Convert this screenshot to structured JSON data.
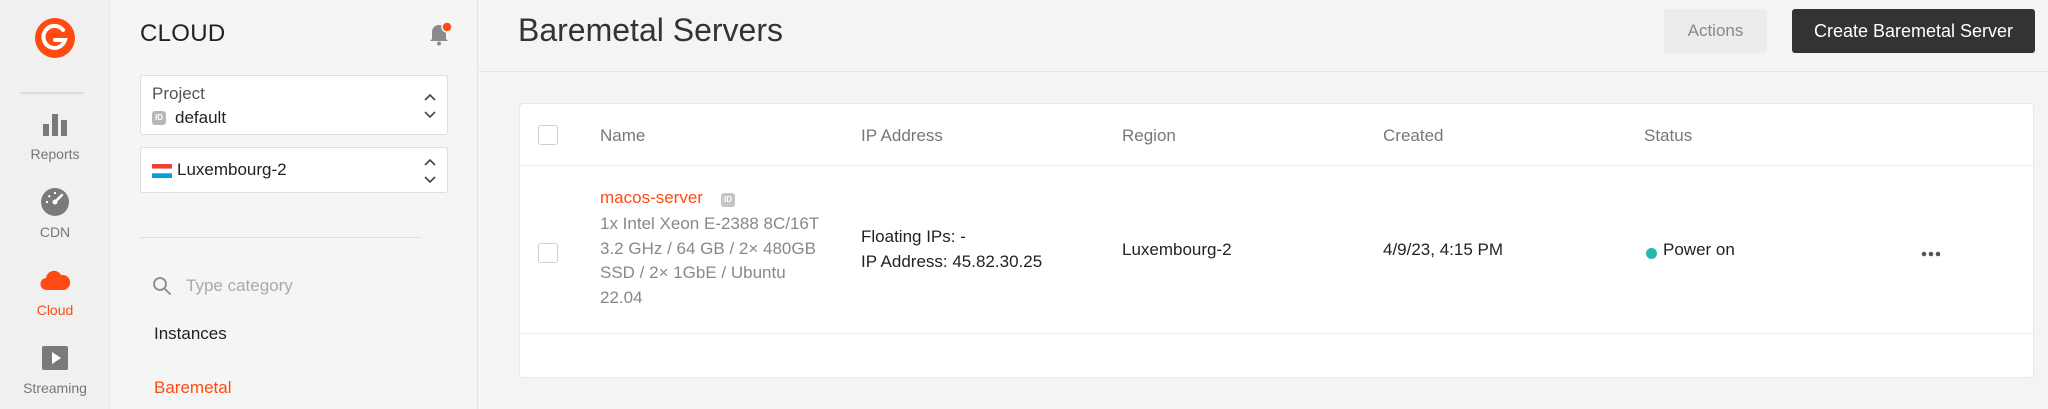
{
  "rail": {
    "items": [
      {
        "label": "Reports",
        "icon": "bar-chart-icon"
      },
      {
        "label": "CDN",
        "icon": "speedometer-icon"
      },
      {
        "label": "Cloud",
        "icon": "cloud-icon",
        "active": true
      },
      {
        "label": "Streaming",
        "icon": "play-icon"
      }
    ]
  },
  "sidebar": {
    "title": "CLOUD",
    "project": {
      "caption": "Project",
      "id_badge": "ID",
      "value": "default"
    },
    "region": {
      "value": "Luxembourg-2"
    },
    "search": {
      "placeholder": "Type category"
    },
    "categories": [
      "Instances",
      "Baremetal"
    ]
  },
  "header": {
    "title": "Baremetal Servers",
    "actions_label": "Actions",
    "create_label": "Create Baremetal Server"
  },
  "table": {
    "columns": [
      "Name",
      "IP Address",
      "Region",
      "Created",
      "Status"
    ],
    "rows": [
      {
        "name": "macos-server",
        "id_badge": "ID",
        "description": "1x Intel Xeon E-2388 8C/16T 3.2 GHz / 64 GB / 2× 480GB SSD / 2× 1GbE / Ubuntu 22.04",
        "floating_ips": "Floating IPs: -",
        "ip_address": "IP Address: 45.82.30.25",
        "region": "Luxembourg-2",
        "created": "4/9/23, 4:15 PM",
        "status": "Power on"
      }
    ]
  },
  "colors": {
    "accent": "#ff4b12",
    "status_on": "#26b8b0",
    "dark_button": "#333333"
  }
}
